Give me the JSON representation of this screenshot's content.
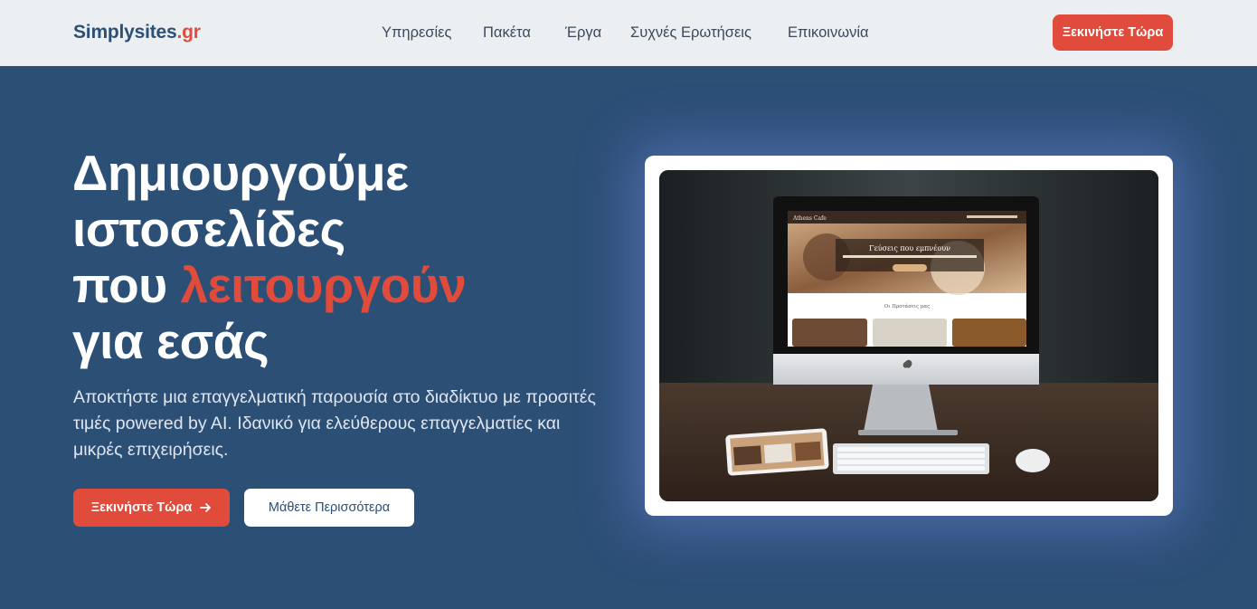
{
  "header": {
    "logo_main": "Simplysites",
    "logo_tld": ".gr",
    "nav": [
      "Υπηρεσίες",
      "Πακέτα",
      "Έργα",
      "Συχνές Ερωτήσεις",
      "Επικοινωνία"
    ],
    "cta_label": "Ξεκινήστε Τώρα"
  },
  "hero": {
    "title_line1": "Δημιουργούμε",
    "title_line2": "ιστοσελίδες",
    "title_line3_plain": "που ",
    "title_line3_accent": "λειτουργούν",
    "title_line4": "για εσάς",
    "subtitle": "Αποκτήστε μια επαγγελματική παρουσία στο διαδίκτυο με προσιτές τιμές powered by AI. Ιδανικό για ελεύθερους επαγγελματίες και μικρές επιχειρήσεις.",
    "primary_button": "Ξεκινήστε Τώρα",
    "secondary_button": "Μάθετε Περισσότερα",
    "screen_site_title": "Athens Cafe",
    "screen_headline": "Γεύσεις που εμπνέουν",
    "screen_section": "Οι Προτάσεις μας"
  },
  "colors": {
    "brand_navy": "#2c4f76",
    "accent_red": "#e04b3b",
    "header_bg": "#eceff2"
  }
}
